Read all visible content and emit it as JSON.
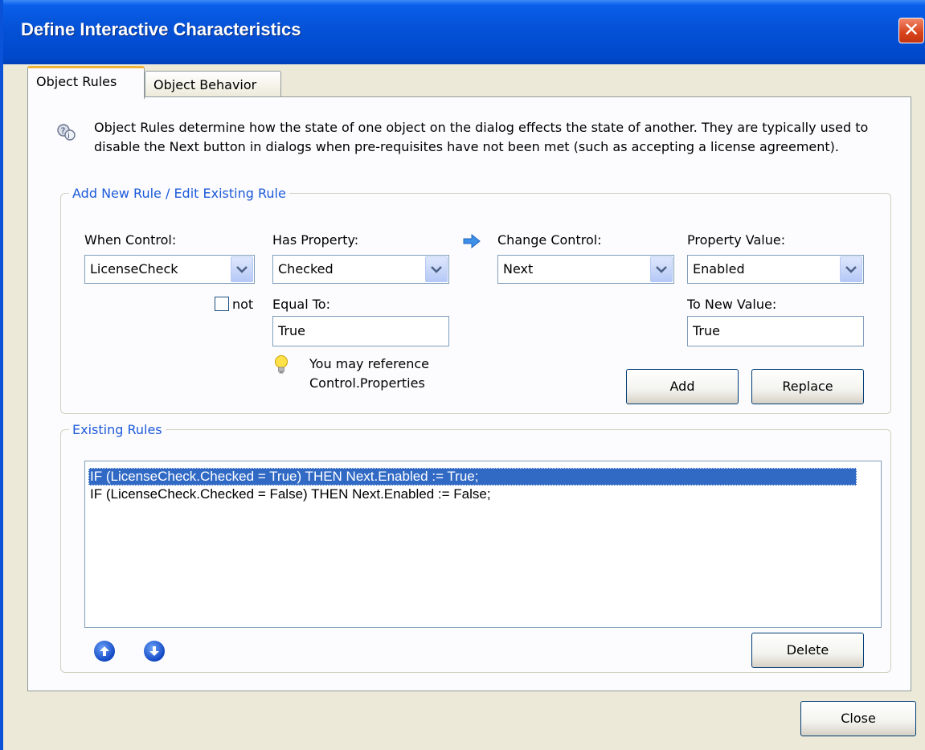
{
  "window": {
    "title": "Define Interactive Characteristics"
  },
  "tabs": [
    {
      "label": "Object Rules",
      "active": true
    },
    {
      "label": "Object Behavior",
      "active": false
    }
  ],
  "intro_text": "Object Rules determine how the state of one object on the dialog effects the state of another. They are typically used to disable the Next button in dialogs when pre-requisites have not been met (such as accepting a license agreement).",
  "rule_group": {
    "legend": "Add New Rule / Edit Existing Rule",
    "when_control_label": "When Control:",
    "when_control_value": "LicenseCheck",
    "has_property_label": "Has Property:",
    "has_property_value": "Checked",
    "change_control_label": "Change Control:",
    "change_control_value": "Next",
    "property_value_label": "Property Value:",
    "property_value_value": "Enabled",
    "not_label": "not",
    "not_checked": false,
    "equal_to_label": "Equal To:",
    "equal_to_value": "True",
    "to_new_value_label": "To New Value:",
    "to_new_value_value": "True",
    "hint_line1": "You may reference",
    "hint_line2": "Control.Properties",
    "add_button": "Add",
    "replace_button": "Replace"
  },
  "existing_group": {
    "legend": "Existing Rules",
    "rules": [
      "IF (LicenseCheck.Checked = True)  THEN  Next.Enabled := True;",
      "IF (LicenseCheck.Checked = False)  THEN  Next.Enabled := False;"
    ],
    "selected_index": 0,
    "delete_button": "Delete"
  },
  "close_button": "Close",
  "colors": {
    "title_bar": "#0553d8",
    "selection": "#316ac5",
    "group_legend": "#1c5ad8"
  }
}
